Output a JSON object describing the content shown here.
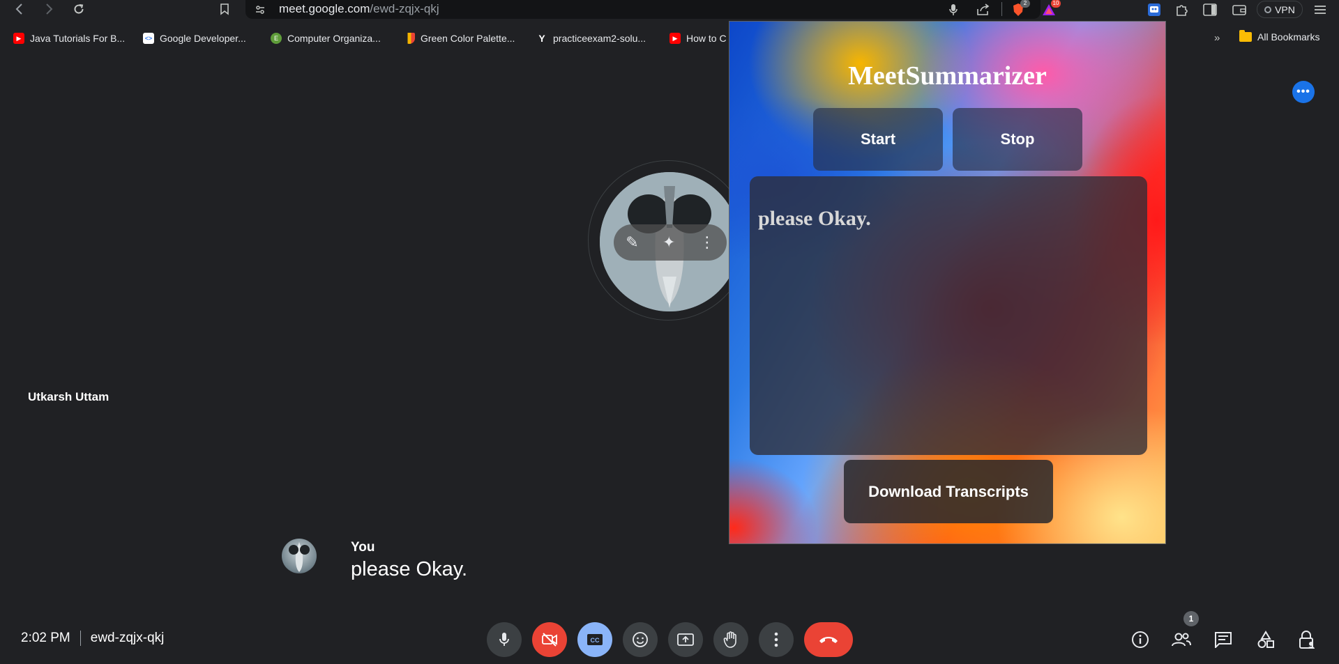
{
  "browser": {
    "url_host": "meet.google.com",
    "url_path": "/ewd-zqjx-qkj",
    "extension_badges": {
      "brave_shields": "2",
      "rewards": "10"
    },
    "vpn_label": "VPN"
  },
  "bookmarks": {
    "items": [
      {
        "label": "Java Tutorials For B...",
        "icon": "youtube-icon",
        "color": "#ff0000"
      },
      {
        "label": "Google Developer...",
        "icon": "google-dev-icon",
        "color": "#ffffff"
      },
      {
        "label": "Computer Organiza...",
        "icon": "site-logo-icon",
        "color": "#5f9d3a"
      },
      {
        "label": "Green Color Palette...",
        "icon": "palette-icon",
        "color": "#f4b400"
      },
      {
        "label": "practiceexam2-solu...",
        "icon": "y-logo-icon",
        "color": "#ffffff"
      },
      {
        "label": "How to C",
        "icon": "youtube-icon",
        "color": "#ff0000"
      }
    ],
    "overflow": "»",
    "all_bookmarks": "All Bookmarks"
  },
  "meet": {
    "participant_name": "Utkarsh Uttam",
    "caption_speaker": "You",
    "caption_text": "please Okay.",
    "time": "2:02 PM",
    "meeting_code": "ewd-zqjx-qkj",
    "people_count": "1"
  },
  "extension": {
    "title": "MeetSummarizer",
    "start_label": "Start",
    "stop_label": "Stop",
    "transcript_text": "please Okay.",
    "download_label": "Download Transcripts"
  },
  "colors": {
    "meet_background": "#202124",
    "end_call": "#ea4335",
    "captions_active": "#8ab4f8",
    "more_options": "#1a73e8"
  }
}
